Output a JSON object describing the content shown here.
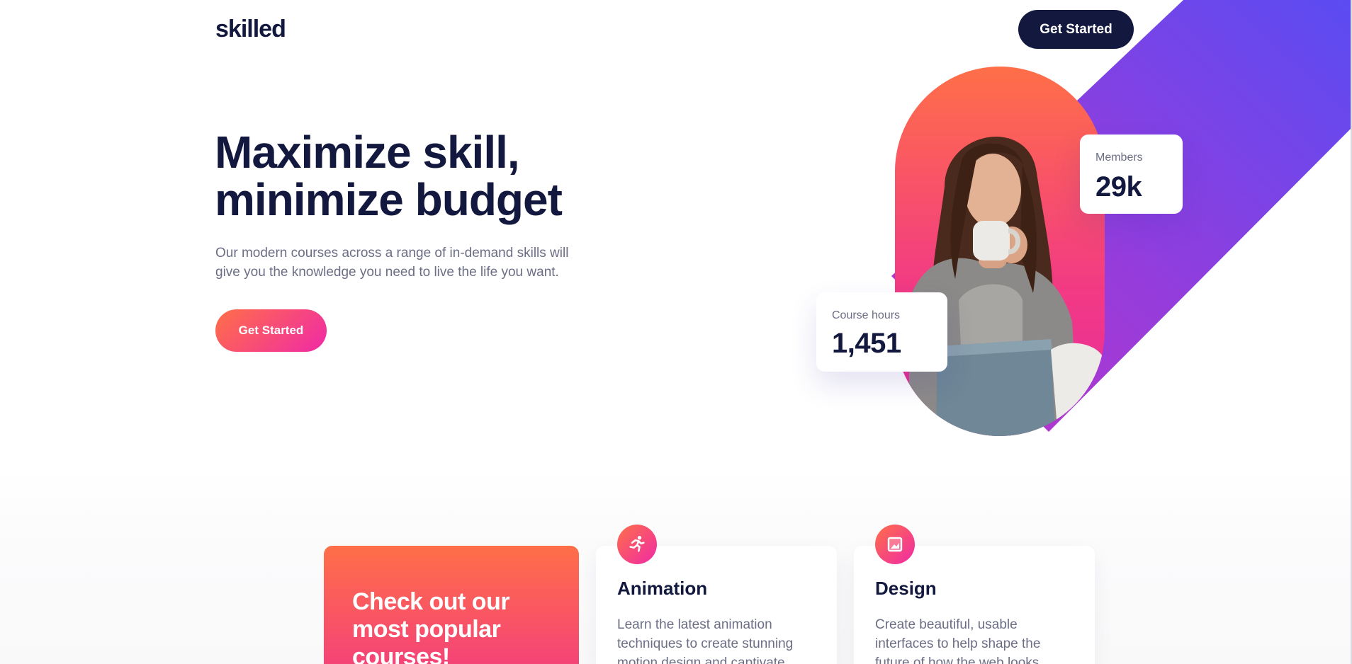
{
  "header": {
    "logo": "skilled",
    "cta_label": "Get Started"
  },
  "hero": {
    "title_line1": "Maximize skill,",
    "title_line2": "minimize budget",
    "subtitle": "Our modern courses across a range of in-demand skills will give you the knowledge you need to live the life you want.",
    "cta_label": "Get Started"
  },
  "stats": {
    "members_label": "Members",
    "members_value": "29k",
    "hours_label": "Course hours",
    "hours_value": "1,451"
  },
  "courses": {
    "promo_line1": "Check out our",
    "promo_line2": "most popular",
    "promo_line3": "courses!",
    "items": [
      {
        "icon": "running-person-icon",
        "title": "Animation",
        "description": "Learn the latest animation techniques to create stunning motion design and captivate"
      },
      {
        "icon": "image-frame-icon",
        "title": "Design",
        "description": "Create beautiful, usable interfaces to help shape the future of how the web looks"
      }
    ]
  },
  "colors": {
    "navy": "#13183f",
    "orange": "#ff6f48",
    "pink": "#f02aa6",
    "purple": "#6a4cf0",
    "muted_text": "#6b6e85"
  }
}
